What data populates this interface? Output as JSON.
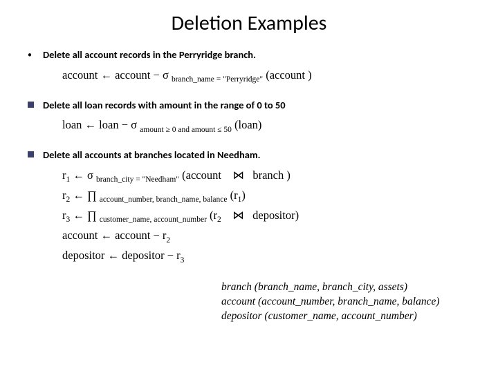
{
  "title": "Deletion Examples",
  "items": [
    {
      "bullet": "dot",
      "desc": "Delete all account records in the Perryridge branch.",
      "exprs": [
        {
          "html": "account <span class='sym'>←</span> account − <span class='sym'>σ</span> <span class='sub'>branch_name = \"Perryridge\"</span> (account )"
        }
      ]
    },
    {
      "bullet": "square",
      "desc": "Delete all loan records with amount in the range of 0 to 50",
      "exprs": [
        {
          "html": "loan <span class='sym'>←</span> loan − <span class='sym'>σ</span> <span class='sub'>amount ≥ 0 and amount ≤ 50</span> (loan)"
        }
      ]
    },
    {
      "bullet": "square",
      "desc": "Delete all accounts at branches located in Needham.",
      "exprs": [
        {
          "html": "r<span class='sub'>1</span> <span class='sym'>←</span> <span class='sym'>σ</span> <span class='sub'>branch_city = \"Needham\"</span> (account &nbsp;&nbsp;&nbsp;<span class='join'>⋈</span>&nbsp;&nbsp; branch )"
        },
        {
          "html": "r<span class='sub'>2</span> <span class='sym'>←</span> <span class='sym'>∏</span> <span class='sub'>account_number, branch_name, balance</span> (r<span class='sub'>1</span>)"
        },
        {
          "html": "r<span class='sub'>3</span> <span class='sym'>←</span> <span class='sym'>∏</span> <span class='sub'>customer_name, account_number</span> (r<span class='sub'>2</span> &nbsp;&nbsp;&nbsp;<span class='join'>⋈</span>&nbsp;&nbsp; depositor)<br>account <span class='sym'>←</span> account − r<span class='sub'>2</span>"
        },
        {
          "html": "depositor <span class='sym'>←</span> depositor − r<span class='sub'>3</span>"
        }
      ]
    }
  ],
  "schemas": [
    "branch (branch_name, branch_city, assets)",
    "account (account_number, branch_name, balance)",
    "depositor (customer_name, account_number)"
  ]
}
